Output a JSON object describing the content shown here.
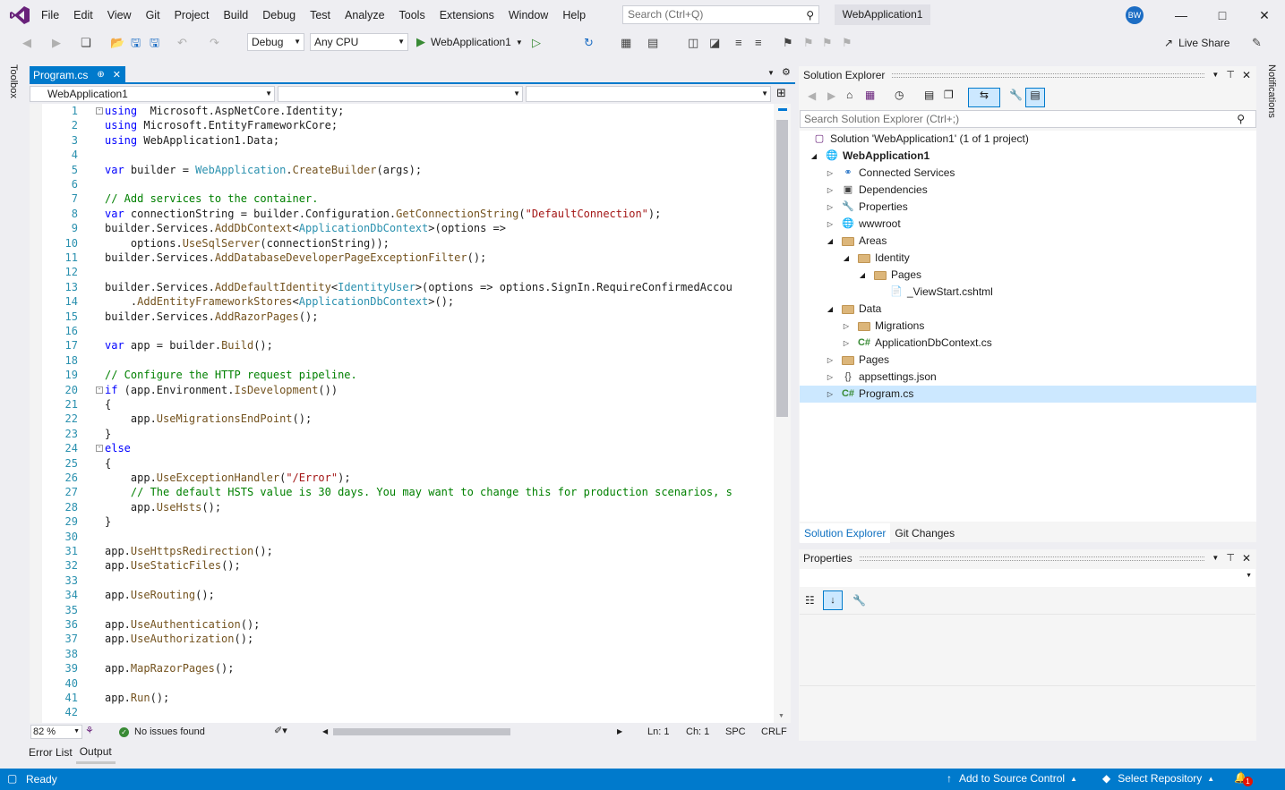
{
  "menu": [
    "File",
    "Edit",
    "View",
    "Git",
    "Project",
    "Build",
    "Debug",
    "Test",
    "Analyze",
    "Tools",
    "Extensions",
    "Window",
    "Help"
  ],
  "search": {
    "placeholder": "Search (Ctrl+Q)"
  },
  "solution_name": "WebApplication1",
  "avatar": "BW",
  "toolbar": {
    "config": "Debug",
    "platform": "Any CPU",
    "run_target": "WebApplication1",
    "live_share": "Live Share"
  },
  "side": {
    "toolbox": "Toolbox",
    "notifications": "Notifications"
  },
  "editor": {
    "tab": "Program.cs",
    "nav_project": "WebApplication1",
    "zoom": "82 %",
    "issues": "No issues found",
    "ln": "Ln: 1",
    "ch": "Ch: 1",
    "spc": "SPC",
    "crlf": "CRLF",
    "lines": [
      [
        [
          "kw",
          "using"
        ],
        [
          "",
          "  Microsoft.AspNetCore.Identity;"
        ]
      ],
      [
        [
          "kw",
          "using"
        ],
        [
          "",
          " Microsoft.EntityFrameworkCore;"
        ]
      ],
      [
        [
          "kw",
          "using"
        ],
        [
          "",
          " WebApplication1.Data;"
        ]
      ],
      [],
      [
        [
          "kw",
          "var"
        ],
        [
          "",
          " builder = "
        ],
        [
          "ty",
          "WebApplication"
        ],
        [
          "",
          "."
        ],
        [
          "me",
          "CreateBuilder"
        ],
        [
          "",
          "(args);"
        ]
      ],
      [],
      [
        [
          "cm",
          "// Add services to the container."
        ]
      ],
      [
        [
          "kw",
          "var"
        ],
        [
          "",
          " connectionString = builder.Configuration."
        ],
        [
          "me",
          "GetConnectionString"
        ],
        [
          "",
          "("
        ],
        [
          "st",
          "\"DefaultConnection\""
        ],
        [
          "",
          ");"
        ]
      ],
      [
        [
          "",
          "builder.Services."
        ],
        [
          "me",
          "AddDbContext"
        ],
        [
          "",
          "<"
        ],
        [
          "ty",
          "ApplicationDbContext"
        ],
        [
          "",
          ">(options =>"
        ]
      ],
      [
        [
          "",
          "    options."
        ],
        [
          "me",
          "UseSqlServer"
        ],
        [
          "",
          "(connectionString));"
        ]
      ],
      [
        [
          "",
          "builder.Services."
        ],
        [
          "me",
          "AddDatabaseDeveloperPageExceptionFilter"
        ],
        [
          "",
          "();"
        ]
      ],
      [],
      [
        [
          "",
          "builder.Services."
        ],
        [
          "me",
          "AddDefaultIdentity"
        ],
        [
          "",
          "<"
        ],
        [
          "ty",
          "IdentityUser"
        ],
        [
          "",
          ">(options => options.SignIn.RequireConfirmedAccou"
        ]
      ],
      [
        [
          "",
          "    ."
        ],
        [
          "me",
          "AddEntityFrameworkStores"
        ],
        [
          "",
          "<"
        ],
        [
          "ty",
          "ApplicationDbContext"
        ],
        [
          "",
          ">();"
        ]
      ],
      [
        [
          "",
          "builder.Services."
        ],
        [
          "me",
          "AddRazorPages"
        ],
        [
          "",
          "();"
        ]
      ],
      [],
      [
        [
          "kw",
          "var"
        ],
        [
          "",
          " app = builder."
        ],
        [
          "me",
          "Build"
        ],
        [
          "",
          "();"
        ]
      ],
      [],
      [
        [
          "cm",
          "// Configure the HTTP request pipeline."
        ]
      ],
      [
        [
          "kw",
          "if"
        ],
        [
          "",
          " (app.Environment."
        ],
        [
          "me",
          "IsDevelopment"
        ],
        [
          "",
          "())"
        ]
      ],
      [
        [
          "",
          "{"
        ]
      ],
      [
        [
          "",
          "    app."
        ],
        [
          "me",
          "UseMigrationsEndPoint"
        ],
        [
          "",
          "();"
        ]
      ],
      [
        [
          "",
          "}"
        ]
      ],
      [
        [
          "kw",
          "else"
        ]
      ],
      [
        [
          "",
          "{"
        ]
      ],
      [
        [
          "",
          "    app."
        ],
        [
          "me",
          "UseExceptionHandler"
        ],
        [
          "",
          "("
        ],
        [
          "st",
          "\"/Error\""
        ],
        [
          "",
          ");"
        ]
      ],
      [
        [
          "cm",
          "    // The default HSTS value is 30 days. You may want to change this for production scenarios, s"
        ]
      ],
      [
        [
          "",
          "    app."
        ],
        [
          "me",
          "UseHsts"
        ],
        [
          "",
          "();"
        ]
      ],
      [
        [
          "",
          "}"
        ]
      ],
      [],
      [
        [
          "",
          "app."
        ],
        [
          "me",
          "UseHttpsRedirection"
        ],
        [
          "",
          "();"
        ]
      ],
      [
        [
          "",
          "app."
        ],
        [
          "me",
          "UseStaticFiles"
        ],
        [
          "",
          "();"
        ]
      ],
      [],
      [
        [
          "",
          "app."
        ],
        [
          "me",
          "UseRouting"
        ],
        [
          "",
          "();"
        ]
      ],
      [],
      [
        [
          "",
          "app."
        ],
        [
          "me",
          "UseAuthentication"
        ],
        [
          "",
          "();"
        ]
      ],
      [
        [
          "",
          "app."
        ],
        [
          "me",
          "UseAuthorization"
        ],
        [
          "",
          "();"
        ]
      ],
      [],
      [
        [
          "",
          "app."
        ],
        [
          "me",
          "MapRazorPages"
        ],
        [
          "",
          "();"
        ]
      ],
      [],
      [
        [
          "",
          "app."
        ],
        [
          "me",
          "Run"
        ],
        [
          "",
          "();"
        ]
      ],
      []
    ]
  },
  "bottom_tabs": [
    "Error List",
    "Output"
  ],
  "solution_explorer": {
    "title": "Solution Explorer",
    "search_placeholder": "Search Solution Explorer (Ctrl+;)",
    "items": [
      {
        "label": "Solution 'WebApplication1' (1 of 1 project)",
        "depth": 0,
        "exp": "",
        "icon": "solution"
      },
      {
        "label": "WebApplication1",
        "depth": 0,
        "exp": "open",
        "icon": "project",
        "bold": true
      },
      {
        "label": "Connected Services",
        "depth": 1,
        "exp": "closed",
        "icon": "connected"
      },
      {
        "label": "Dependencies",
        "depth": 1,
        "exp": "closed",
        "icon": "deps"
      },
      {
        "label": "Properties",
        "depth": 1,
        "exp": "closed",
        "icon": "props"
      },
      {
        "label": "wwwroot",
        "depth": 1,
        "exp": "closed",
        "icon": "globe"
      },
      {
        "label": "Areas",
        "depth": 1,
        "exp": "open",
        "icon": "folder"
      },
      {
        "label": "Identity",
        "depth": 2,
        "exp": "open",
        "icon": "folder"
      },
      {
        "label": "Pages",
        "depth": 3,
        "exp": "open",
        "icon": "folder"
      },
      {
        "label": "_ViewStart.cshtml",
        "depth": 4,
        "exp": "",
        "icon": "file"
      },
      {
        "label": "Data",
        "depth": 1,
        "exp": "open",
        "icon": "folder"
      },
      {
        "label": "Migrations",
        "depth": 2,
        "exp": "closed",
        "icon": "folder"
      },
      {
        "label": "ApplicationDbContext.cs",
        "depth": 2,
        "exp": "closed",
        "icon": "cs"
      },
      {
        "label": "Pages",
        "depth": 1,
        "exp": "closed",
        "icon": "folder"
      },
      {
        "label": "appsettings.json",
        "depth": 1,
        "exp": "closed",
        "icon": "json"
      },
      {
        "label": "Program.cs",
        "depth": 1,
        "exp": "closed",
        "icon": "cs",
        "selected": true
      }
    ],
    "tabs": [
      "Solution Explorer",
      "Git Changes"
    ]
  },
  "properties": {
    "title": "Properties"
  },
  "status": {
    "ready": "Ready",
    "source_control": "Add to Source Control",
    "repository": "Select Repository",
    "notif_count": "1"
  },
  "colors": {
    "accent": "#007acc",
    "status_bar": "#007acc",
    "vs_purple": "#68217a"
  }
}
